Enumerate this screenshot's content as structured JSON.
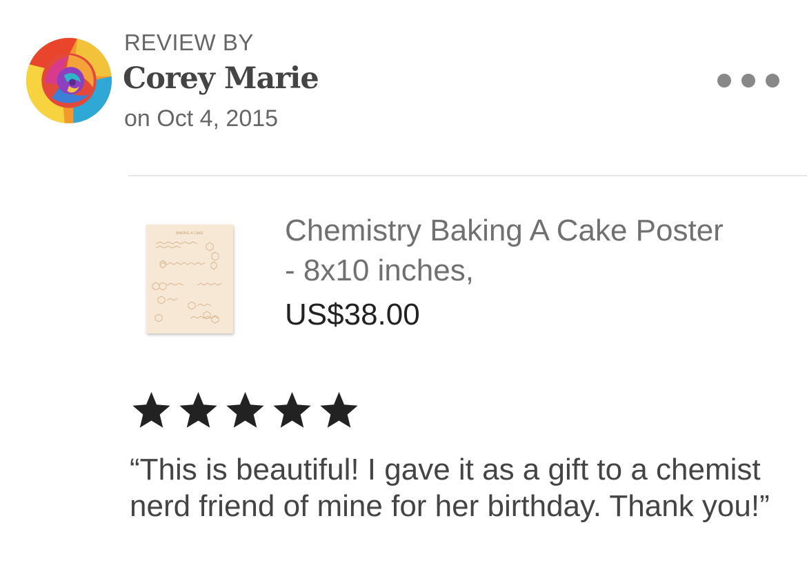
{
  "reviewer": {
    "heading": "REVIEW BY",
    "name": "Corey Marie",
    "date": "on Oct 4, 2015"
  },
  "product": {
    "title": "Chemistry Baking A Cake Poster - 8x10 inches,",
    "price": "US$38.00",
    "thumbnail_caption": "BAKING A CAKE"
  },
  "rating": {
    "stars": 5,
    "max": 5
  },
  "review": {
    "text": "“This is beautiful! I gave it as a gift to a chemist nerd friend of mine for her birthday. Thank you!”"
  },
  "icons": {
    "more": "more-dots-icon",
    "star": "star-icon",
    "avatar": "rainbow-rose-image"
  },
  "colors": {
    "star": "#222222",
    "muted_text": "#666666",
    "name_text": "#444444",
    "price_text": "#222222",
    "divider": "#e6e6e6",
    "thumbnail_bg": "#f5e6d2"
  }
}
